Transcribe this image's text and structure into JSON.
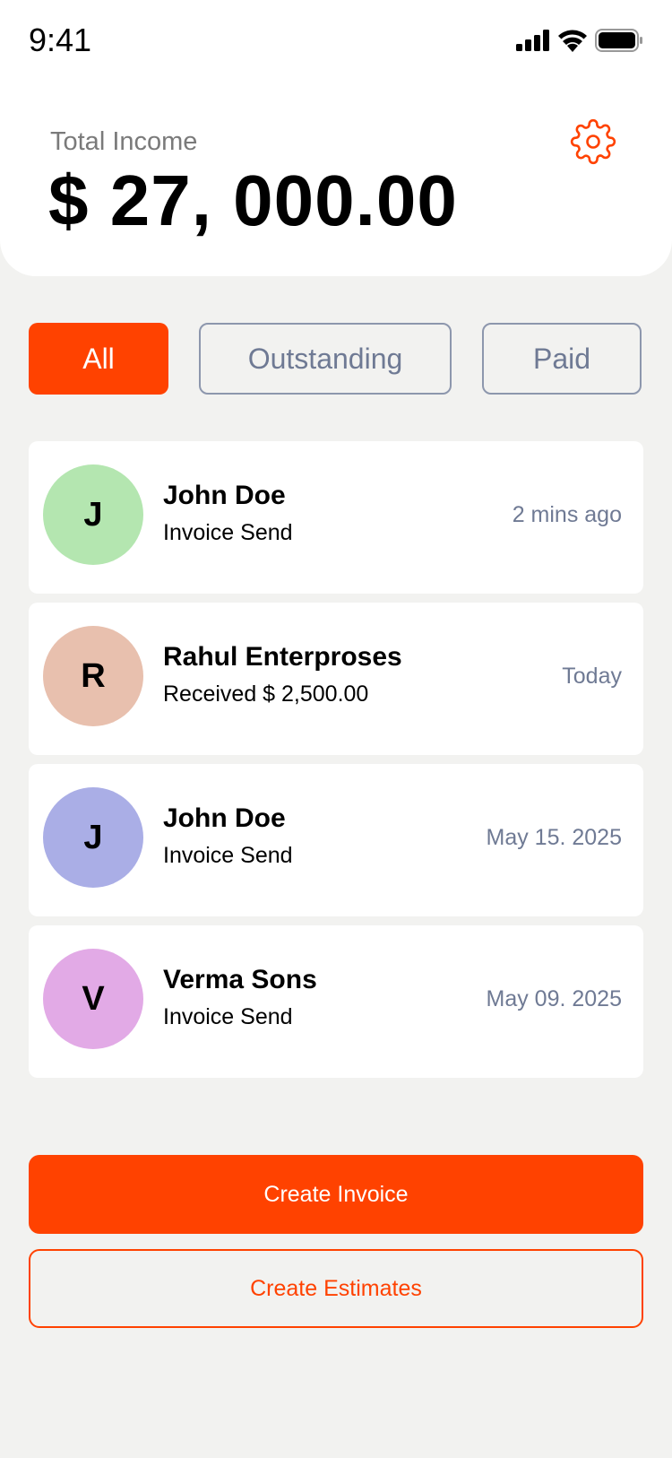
{
  "status_bar": {
    "time": "9:41",
    "icons": [
      "cellular-signal-icon",
      "wifi-icon",
      "battery-icon"
    ]
  },
  "summary": {
    "label": "Total Income",
    "value": "$ 27, 000.00",
    "settings_icon": "gear-icon"
  },
  "filters": [
    {
      "label": "All",
      "selected": true
    },
    {
      "label": "Outstanding",
      "selected": false
    },
    {
      "label": "Paid",
      "selected": false
    }
  ],
  "activities": [
    {
      "initial": "J",
      "name": "John Doe",
      "detail": "Invoice Send",
      "time": "2 mins ago",
      "avatar_color": "#b4e6b0"
    },
    {
      "initial": "R",
      "name": "Rahul Enterproses",
      "detail": "Received $ 2,500.00",
      "time": "Today",
      "avatar_color": "#e8c0ae"
    },
    {
      "initial": "J",
      "name": "John Doe",
      "detail": "Invoice Send",
      "time": "May 15. 2025",
      "avatar_color": "#aaaee6"
    },
    {
      "initial": "V",
      "name": "Verma Sons",
      "detail": "Invoice Send",
      "time": "May 09. 2025",
      "avatar_color": "#e2aae6"
    }
  ],
  "actions": {
    "create_invoice": "Create Invoice",
    "create_estimates": "Create Estimates"
  },
  "colors": {
    "accent": "#ff4200",
    "muted_text": "#6f7a94",
    "background": "#f2f2f0"
  }
}
